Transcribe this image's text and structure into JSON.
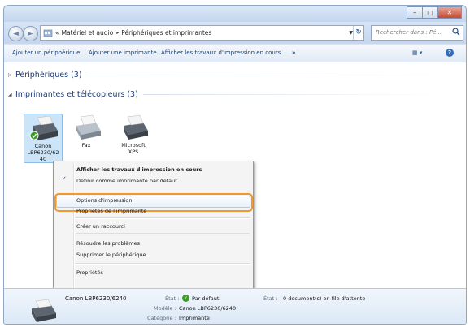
{
  "window": {
    "controls": [
      "–",
      "□",
      "✕"
    ]
  },
  "nav": {
    "back_glyph": "◄",
    "forward_glyph": "►"
  },
  "address": {
    "overflow": "«",
    "crumbs": [
      "Matériel et audio",
      "Périphériques et imprimantes"
    ],
    "separator": "▸",
    "dropdown": "▼",
    "refresh": "↻"
  },
  "search": {
    "placeholder": "Rechercher dans : Pé...",
    "icon": "search-icon"
  },
  "commands": {
    "add_device": "Ajouter un périphérique",
    "add_printer": "Ajouter une imprimante",
    "see_print_jobs": "Afficher les travaux d'impression en cours",
    "more": "»",
    "view_icon": "▦ ▾",
    "help_icon": "?"
  },
  "groups": {
    "devices": {
      "arrow": "▷",
      "label": "Périphériques (3)"
    },
    "printers": {
      "arrow": "◢",
      "label": "Imprimantes et télécopieurs (3)"
    }
  },
  "printers": [
    {
      "label_lines": [
        "Canon",
        "LBP6230/62",
        "40"
      ],
      "selected": true,
      "default": true,
      "icon": "printer-icon"
    },
    {
      "label_lines": [
        "Fax",
        "",
        ""
      ],
      "selected": false,
      "default": false,
      "icon": "fax-icon"
    },
    {
      "label_lines": [
        "Microsoft",
        "XPS",
        ""
      ],
      "selected": false,
      "default": false,
      "icon": "printer-icon"
    }
  ],
  "context_menu": {
    "see_jobs": "Afficher les travaux d'impression en cours",
    "set_default": "Définir comme imprimante par défaut",
    "check_glyph": "✓",
    "print_options": "Options d'impression",
    "printer_props": "Propriétés de l'imprimante",
    "create_shortcut": "Créer un raccourci",
    "troubleshoot": "Résoudre les problèmes",
    "remove_device": "Supprimer le périphérique",
    "properties": "Propriétés"
  },
  "details": {
    "name": "Canon LBP6230/6240",
    "state_label": "État :",
    "state_check": "✓",
    "state_value": "Par défaut",
    "model_label": "Modèle :",
    "model_value": "Canon LBP6230/6240",
    "category_label": "Catégorie :",
    "category_value": "Imprimante",
    "queue_label": "État :",
    "queue_value": "0 document(s) en file d'attente"
  },
  "colors": {
    "highlight_ring": "#f1972c",
    "default_badge": "#3f9b2c",
    "link_text": "#1e3f6e"
  }
}
